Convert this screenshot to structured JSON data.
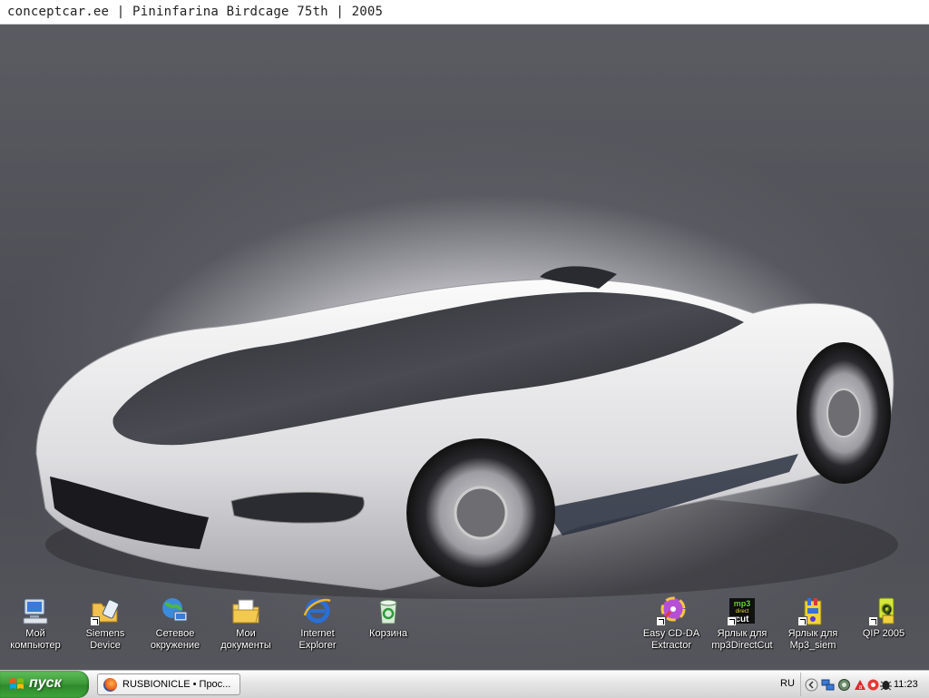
{
  "window": {
    "title": "conceptcar.ee | Pininfarina Birdcage 75th | 2005"
  },
  "desktop_icons": [
    {
      "label": "Мой компьютер",
      "icon": "my-computer-icon"
    },
    {
      "label": "Siemens Device",
      "icon": "siemens-device-icon"
    },
    {
      "label": "Сетевое окружение",
      "icon": "network-places-icon"
    },
    {
      "label": "Мои документы",
      "icon": "my-documents-icon"
    },
    {
      "label": "Internet Explorer",
      "icon": "internet-explorer-icon"
    },
    {
      "label": "Корзина",
      "icon": "recycle-bin-icon"
    },
    {
      "label": "Easy CD-DA Extractor",
      "icon": "easy-cd-da-extractor-icon"
    },
    {
      "label": "Ярлык для mp3DirectCut",
      "icon": "mp3directcut-icon"
    },
    {
      "label": "Ярлык для Mp3_siem",
      "icon": "mp3-siem-icon"
    },
    {
      "label": "QIP 2005",
      "icon": "qip-icon"
    }
  ],
  "taskbar": {
    "start_label": "пуск",
    "tasks": [
      {
        "label": "RUSBIONICLE • Прос...",
        "icon": "firefox-icon"
      }
    ],
    "language": "RU",
    "clock": "11:23",
    "tray_icons": [
      "tray-collapse-icon",
      "network-tray-icon",
      "volume-tray-icon",
      "antivirus-tray-icon",
      "agent-tray-icon",
      "bug-tray-icon"
    ]
  },
  "colors": {
    "start_button": "#3f9c3a",
    "car_body": "#e8e8ea",
    "background": "#55555c"
  }
}
